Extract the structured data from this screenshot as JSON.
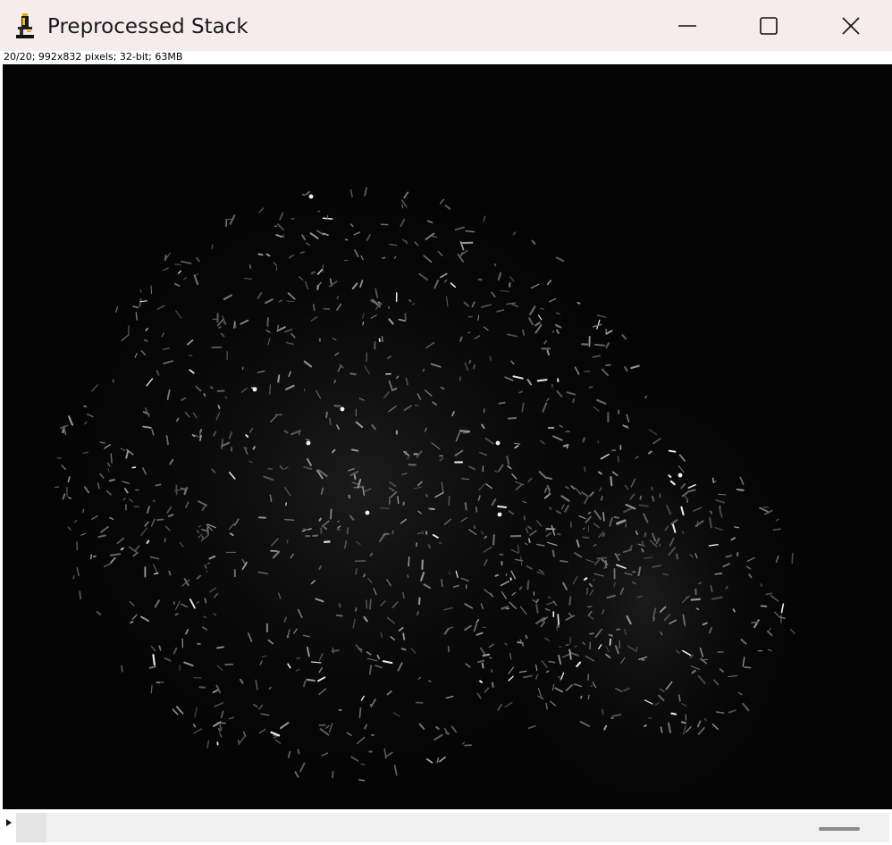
{
  "window": {
    "title": "Preprocessed Stack",
    "app_icon": "microscope-icon",
    "controls": {
      "minimize_icon": "minimize-icon",
      "maximize_icon": "maximize-icon",
      "close_icon": "close-icon"
    }
  },
  "image_info": "20/20; 992x832 pixels; 32-bit; 63MB",
  "stack": {
    "current_slice": 20,
    "total_slices": 20,
    "play_icon": "play-icon"
  },
  "colors": {
    "titlebar": "#f6ecee",
    "canvas_background": "#050505",
    "particles": "#ffffff"
  }
}
